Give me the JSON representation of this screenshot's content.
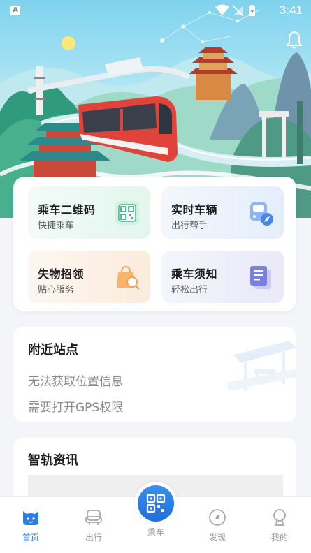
{
  "status_bar": {
    "time": "3:41",
    "notification_icon": "A"
  },
  "quick_actions": [
    {
      "title": "乘车二维码",
      "subtitle": "快捷乘车",
      "icon": "qr-code-icon",
      "color": "#3bb98d"
    },
    {
      "title": "实时车辆",
      "subtitle": "出行帮手",
      "icon": "bus-compass-icon",
      "color": "#4a86e8"
    },
    {
      "title": "失物招领",
      "subtitle": "贴心服务",
      "icon": "shopping-bag-search-icon",
      "color": "#f3a257"
    },
    {
      "title": "乘车须知",
      "subtitle": "轻松出行",
      "icon": "document-icon",
      "color": "#6b6fd6"
    }
  ],
  "nearby": {
    "title": "附近站点",
    "message_line1": "无法获取位置信息",
    "message_line2": "需要打开GPS权限"
  },
  "news": {
    "title": "智轨资讯"
  },
  "bottom_nav": {
    "items": [
      {
        "label": "首页",
        "icon": "home-face-icon",
        "active": true
      },
      {
        "label": "出行",
        "icon": "car-icon",
        "active": false
      },
      {
        "label": "乘车",
        "icon": "qr-scan-icon",
        "active": false
      },
      {
        "label": "发现",
        "icon": "compass-icon",
        "active": false
      },
      {
        "label": "我的",
        "icon": "user-icon",
        "active": false
      }
    ]
  },
  "colors": {
    "accent": "#2f7fe0",
    "train": "#e0433a",
    "background": "#f3f5f8"
  }
}
